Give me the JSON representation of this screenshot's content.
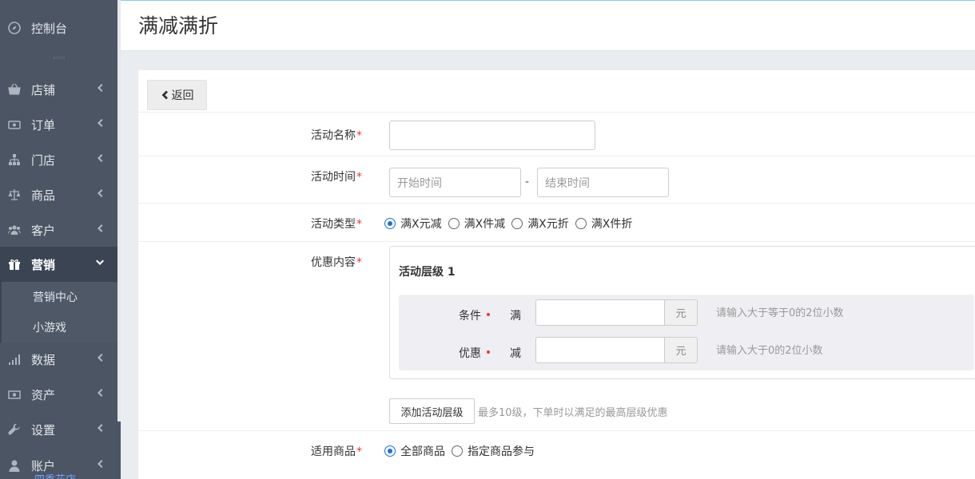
{
  "sidebar": {
    "top_item": {
      "label": "控制台",
      "icon": "compass-icon"
    },
    "items": [
      {
        "label": "店铺",
        "icon": "basket-icon"
      },
      {
        "label": "订单",
        "icon": "money-icon"
      },
      {
        "label": "门店",
        "icon": "sitemap-icon"
      },
      {
        "label": "商品",
        "icon": "balance-scale-icon"
      },
      {
        "label": "客户",
        "icon": "users-icon"
      },
      {
        "label": "营销",
        "icon": "gift-icon"
      },
      {
        "label": "数据",
        "icon": "signal-icon"
      },
      {
        "label": "资产",
        "icon": "money-bill-icon"
      },
      {
        "label": "设置",
        "icon": "wrench-icon"
      },
      {
        "label": "账户",
        "icon": "user-icon"
      }
    ],
    "subitems": [
      {
        "label": "营销中心"
      },
      {
        "label": "小游戏"
      }
    ],
    "footer": "四季花店"
  },
  "header": {
    "title": "满减满折"
  },
  "form": {
    "back_label": "返回",
    "name": {
      "label": "活动名称",
      "required": "*",
      "value": ""
    },
    "time": {
      "label": "活动时间",
      "required": "*",
      "start_placeholder": "开始时间",
      "end_placeholder": "结束时间",
      "separator": "-"
    },
    "type": {
      "label": "活动类型",
      "required": "*",
      "options": [
        "满X元减",
        "满X件减",
        "满X元折",
        "满X件折"
      ],
      "selected": "满X元减"
    },
    "discount": {
      "label": "优惠内容",
      "required": "*",
      "tier_title": "活动层级 1",
      "condition_label": "条件",
      "condition_op": "满",
      "condition_unit": "元",
      "condition_hint": "请输入大于等于0的2位小数",
      "benefit_label": "优惠",
      "benefit_op": "减",
      "benefit_unit": "元",
      "benefit_hint": "请输入大于0的2位小数",
      "add_button": "添加活动层级",
      "add_hint": "最多10级，下单时以满足的最高层级优惠"
    },
    "products": {
      "label": "适用商品",
      "required": "*",
      "options": [
        "全部商品",
        "指定商品参与"
      ],
      "selected": "全部商品"
    }
  },
  "colors": {
    "sidebar_bg": "#4b5563",
    "accent": "#1a6fe0",
    "required": "#e4393c"
  }
}
